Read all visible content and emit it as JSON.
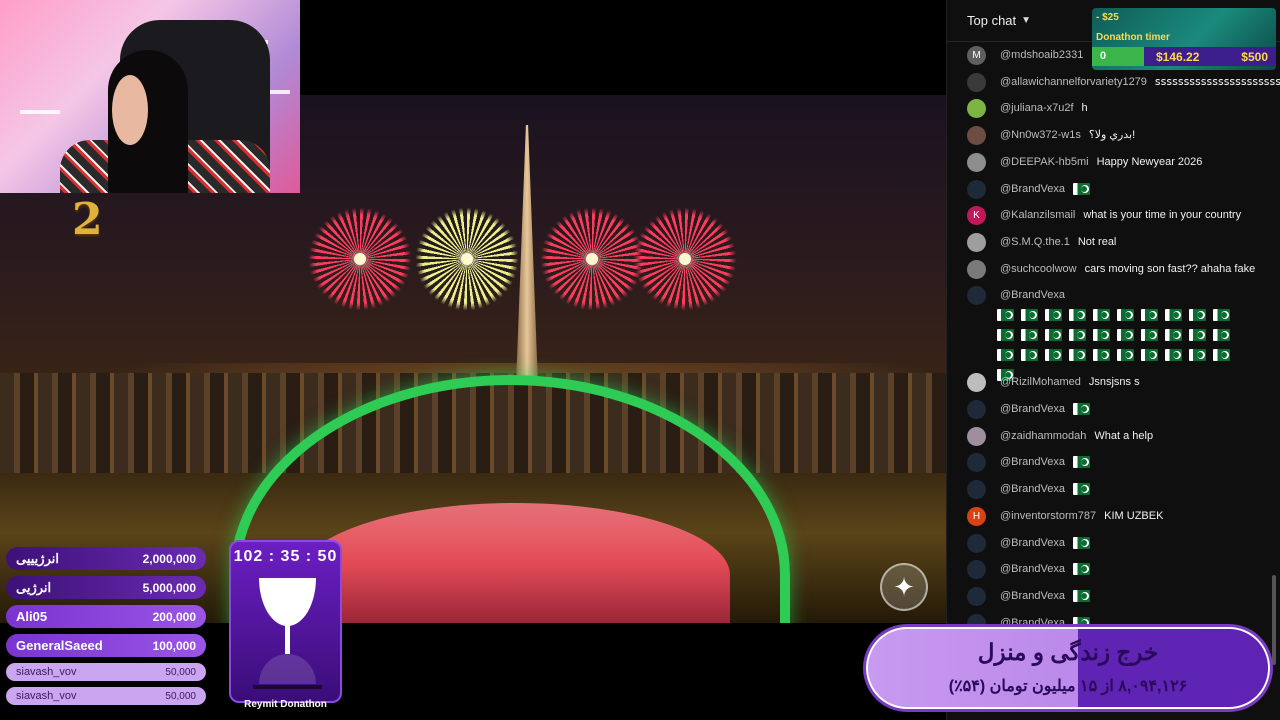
{
  "stream": {
    "badge_numeral": "2",
    "watermark_icon": "sparkle-icon"
  },
  "leaderboard": [
    {
      "name": "انرژیییی",
      "amount": "2,000,000",
      "style": "dark"
    },
    {
      "name": "انرژیی",
      "amount": "5,000,000",
      "style": "dark"
    },
    {
      "name": "Ali05",
      "amount": "200,000",
      "style": "mid"
    },
    {
      "name": "GeneralSaeed",
      "amount": "100,000",
      "style": "mid"
    },
    {
      "name": "siavash_vov",
      "amount": "50,000",
      "style": "light"
    },
    {
      "name": "siavash_vov",
      "amount": "50,000",
      "style": "light"
    }
  ],
  "timer": {
    "time": "102 : 35 : 50",
    "label": "Reymit Donathon",
    "remaining_fraction": 0.65
  },
  "chat": {
    "header_label": "Top chat",
    "messages": [
      {
        "user": "@mdshoaib2331",
        "text": "h",
        "avatar_letter": "M",
        "avatar_color": "#5f5f5f",
        "flags": 0
      },
      {
        "user": "@allawichannelforvariety1279",
        "text": "ꜱꜱꜱꜱꜱꜱꜱꜱꜱꜱꜱꜱꜱꜱꜱꜱꜱꜱꜱꜱꜱꜱꜱꜱ",
        "avatar_letter": "",
        "avatar_color": "#3a3a3a",
        "flags": 0
      },
      {
        "user": "@juliana-x7u2f",
        "text": "h",
        "avatar_letter": "",
        "avatar_color": "#7cb342",
        "flags": 0
      },
      {
        "user": "@Nn0w372-w1s",
        "text": "بدري ولا؟!",
        "avatar_letter": "",
        "avatar_color": "#6d4c41",
        "flags": 0
      },
      {
        "user": "@DEEPAK-hb5mi",
        "text": "Happy Newyear 2026",
        "avatar_letter": "",
        "avatar_color": "#8d8d8d",
        "flags": 0
      },
      {
        "user": "@BrandVexa",
        "text": "",
        "avatar_letter": "",
        "avatar_color": "#1e2a3a",
        "flags": 1
      },
      {
        "user": "@Kalanzilsmail",
        "text": "what is your time in your country",
        "avatar_letter": "K",
        "avatar_color": "#c2185b",
        "flags": 0
      },
      {
        "user": "@S.M.Q.the.1",
        "text": "Not real",
        "avatar_letter": "",
        "avatar_color": "#9e9e9e",
        "flags": 0
      },
      {
        "user": "@suchcoolwow",
        "text": "cars moving son fast?? ahaha fake",
        "avatar_letter": "",
        "avatar_color": "#7a7a7a",
        "flags": 0
      },
      {
        "user": "@BrandVexa",
        "text": "",
        "avatar_letter": "",
        "avatar_color": "#1e2a3a",
        "flags": 31
      },
      {
        "user": "@RizilMohamed",
        "text": "Jsnsjsns s",
        "avatar_letter": "",
        "avatar_color": "#bdbdbd",
        "flags": 0
      },
      {
        "user": "@BrandVexa",
        "text": "",
        "avatar_letter": "",
        "avatar_color": "#1e2a3a",
        "flags": 1
      },
      {
        "user": "@zaidhammodah",
        "text": "What a help",
        "avatar_letter": "",
        "avatar_color": "#9e8e9e",
        "flags": 0
      },
      {
        "user": "@BrandVexa",
        "text": "",
        "avatar_letter": "",
        "avatar_color": "#1e2a3a",
        "flags": 1
      },
      {
        "user": "@BrandVexa",
        "text": "",
        "avatar_letter": "",
        "avatar_color": "#1e2a3a",
        "flags": 1
      },
      {
        "user": "@inventorstorm787",
        "text": "KIM UZBEK",
        "avatar_letter": "H",
        "avatar_color": "#d84315",
        "flags": 0
      },
      {
        "user": "@BrandVexa",
        "text": "",
        "avatar_letter": "",
        "avatar_color": "#1e2a3a",
        "flags": 1
      },
      {
        "user": "@BrandVexa",
        "text": "",
        "avatar_letter": "",
        "avatar_color": "#1e2a3a",
        "flags": 1
      },
      {
        "user": "@BrandVexa",
        "text": "",
        "avatar_letter": "",
        "avatar_color": "#1e2a3a",
        "flags": 1
      },
      {
        "user": "@BrandVexa",
        "text": "",
        "avatar_letter": "",
        "avatar_color": "#1e2a3a",
        "flags": 1
      }
    ]
  },
  "donation_timer": {
    "amount": "- $25",
    "title": "Donathon timer",
    "start": "0",
    "current": "$146.22",
    "goal": "$500",
    "progress_fraction": 0.29
  },
  "goal_banner": {
    "title": "خرج زندگی و منزل",
    "subtitle": "۸,۰۹۴,۱۲۶ از ۱۵ میلیون تومان (۵۴٪)",
    "percent": 54
  }
}
